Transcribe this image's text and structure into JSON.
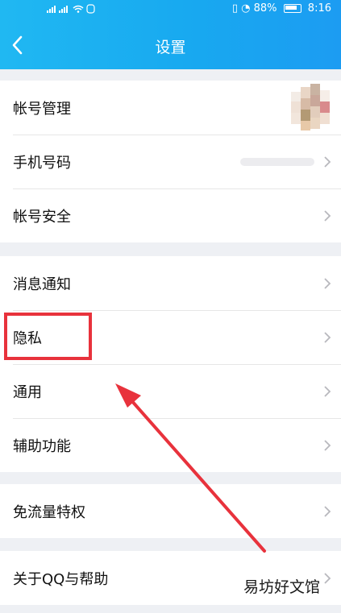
{
  "status_bar": {
    "battery": "88%",
    "time": "8:16"
  },
  "header": {
    "title": "设置"
  },
  "groups": [
    {
      "items": [
        {
          "label": "帐号管理"
        },
        {
          "label": "手机号码"
        },
        {
          "label": "帐号安全"
        }
      ]
    },
    {
      "items": [
        {
          "label": "消息通知"
        },
        {
          "label": "隐私"
        },
        {
          "label": "通用"
        },
        {
          "label": "辅助功能"
        }
      ]
    },
    {
      "items": [
        {
          "label": "免流量特权"
        }
      ]
    },
    {
      "items": [
        {
          "label": "关于QQ与帮助"
        }
      ]
    }
  ],
  "watermark": "易坊好文馆",
  "colors": {
    "header": "#18a9f0",
    "highlight": "#e8323c",
    "background": "#eef0f4"
  }
}
